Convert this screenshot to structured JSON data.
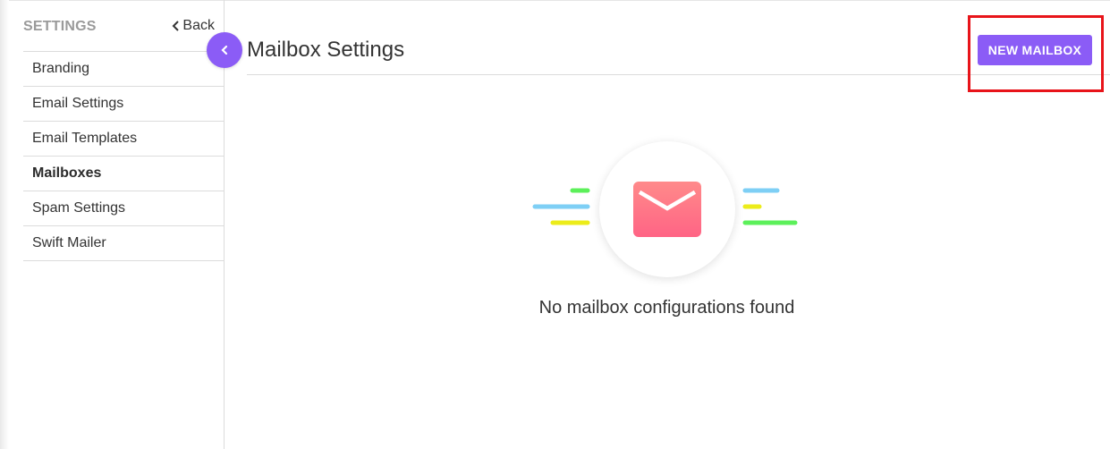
{
  "sidebar": {
    "title": "SETTINGS",
    "back_label": "Back",
    "items": [
      {
        "label": "Branding"
      },
      {
        "label": "Email Settings"
      },
      {
        "label": "Email Templates"
      },
      {
        "label": "Mailboxes"
      },
      {
        "label": "Spam Settings"
      },
      {
        "label": "Swift Mailer"
      }
    ],
    "active_item": "Mailboxes"
  },
  "main": {
    "title": "Mailbox Settings",
    "new_button_label": "NEW MAILBOX",
    "empty_message": "No mailbox configurations found"
  },
  "icons": {
    "collapse": "chevron-left-icon",
    "back": "chevron-left-icon",
    "empty_state": "envelope-icon"
  },
  "colors": {
    "accent": "#8b5cf6",
    "highlight": "#e8141a",
    "envelope": "#ff6f85",
    "line_green": "#5cf05a",
    "line_blue": "#7ecff5",
    "line_yellow": "#ecec1a"
  }
}
